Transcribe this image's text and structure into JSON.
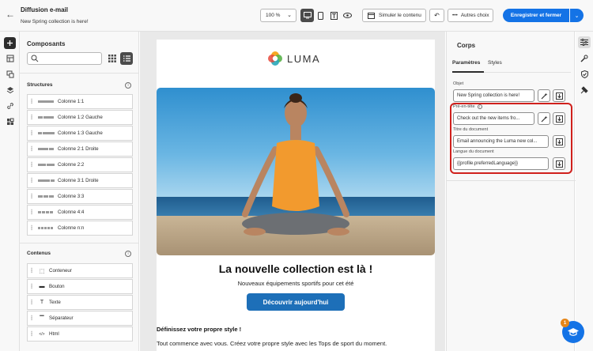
{
  "header": {
    "title": "Diffusion e-mail",
    "subtitle": "New Spring collection is here!",
    "zoom": "100 %",
    "simulate_label": "Simuler le contenu",
    "more_label": "Autres choix",
    "save_label": "Enregistrer et fermer"
  },
  "components": {
    "title": "Composants",
    "search_placeholder": "",
    "structures_title": "Structures",
    "structures": [
      {
        "label": "Colonne 1:1"
      },
      {
        "label": "Colonne 1:2 Gauche"
      },
      {
        "label": "Colonne 1:3 Gauche"
      },
      {
        "label": "Colonne 2:1 Droite"
      },
      {
        "label": "Colonne 2:2"
      },
      {
        "label": "Colonne 3:1 Droite"
      },
      {
        "label": "Colonne 3:3"
      },
      {
        "label": "Colonne 4:4"
      },
      {
        "label": "Colonne n:n"
      }
    ],
    "contenus_title": "Contenus",
    "contenus": [
      {
        "label": "Conteneur",
        "icon": "container-icon"
      },
      {
        "label": "Bouton",
        "icon": "button-icon"
      },
      {
        "label": "Texte",
        "icon": "text-icon"
      },
      {
        "label": "Séparateur",
        "icon": "divider-icon"
      },
      {
        "label": "Html",
        "icon": "html-icon"
      }
    ]
  },
  "email": {
    "logo_text": "LUMA",
    "headline": "La nouvelle collection est là !",
    "subheadline": "Nouveaux équipements sportifs pour cet été",
    "cta_label": "Découvrir aujourd'hui",
    "body_heading": "Définissez votre propre style !",
    "body_text": "Tout commence avec vous. Créez votre propre style avec les Tops de sport du moment."
  },
  "properties": {
    "title": "Corps",
    "tab_params": "Paramètres",
    "tab_styles": "Styles",
    "objet_label": "Objet",
    "objet_value": "New Spring collection is here!",
    "preheader_label": "Pré-en-tête",
    "preheader_value": "Check out the new items fro...",
    "doc_title_label": "Titre du document",
    "doc_title_value": "Email announcing the Luma new col...",
    "lang_label": "Langue du document",
    "lang_value": "{{profile.preferredLanguage}}"
  },
  "help_badge": "1",
  "colors": {
    "accent": "#1473e6",
    "highlight": "#d0201c",
    "cta": "#1d6fb8"
  }
}
